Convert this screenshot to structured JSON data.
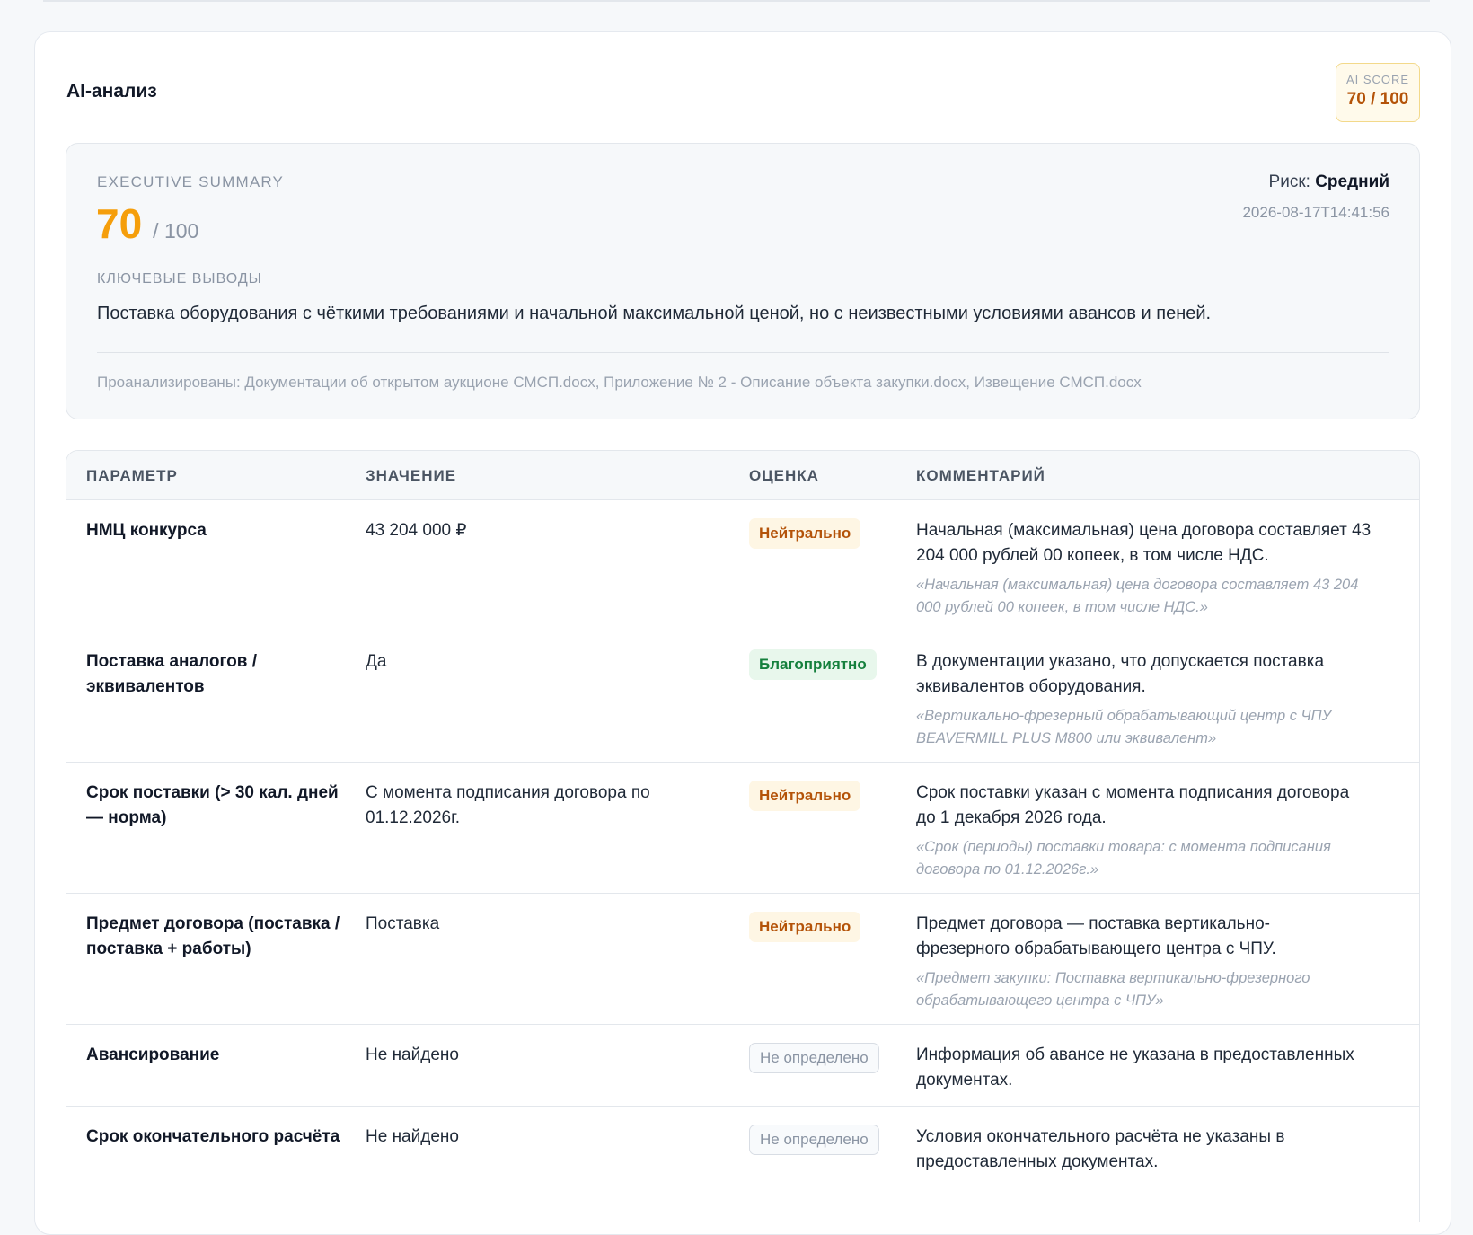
{
  "card": {
    "title": "AI-анализ",
    "ai_score": {
      "label": "AI SCORE",
      "value": "70 / 100"
    }
  },
  "summary": {
    "label": "EXECUTIVE SUMMARY",
    "score": "70",
    "score_denominator": "/ 100",
    "risk_label": "Риск:",
    "risk_value": "Средний",
    "timestamp": "2026-08-17T14:41:56",
    "key_findings_label": "КЛЮЧЕВЫЕ ВЫВОДЫ",
    "key_findings_text": "Поставка оборудования с чёткими требованиями и начальной максимальной ценой, но с неизвестными условиями авансов и пеней.",
    "analyzed": "Проанализированы: Документации об открытом аукционе СМСП.docx, Приложение № 2 - Описание объекта закупки.docx, Извещение СМСП.docx"
  },
  "table": {
    "headers": [
      "ПАРАМЕТР",
      "ЗНАЧЕНИЕ",
      "ОЦЕНКА",
      "КОММЕНТАРИЙ"
    ],
    "rows": [
      {
        "param": "НМЦ конкурса",
        "value": "43 204 000 ₽",
        "eval": "Нейтрально",
        "comment": "Начальная (максимальная) цена договора составляет 43 204 000 рублей 00 копеек, в том числе НДС.",
        "quote": "«Начальная (максимальная) цена договора составляет 43 204 000 рублей 00 копеек, в том числе НДС.»"
      },
      {
        "param": "Поставка аналогов / эквивалентов",
        "value": "Да",
        "eval": "Благоприятно",
        "comment": "В документации указано, что допускается поставка эквивалентов оборудования.",
        "quote": "«Вертикально-фрезерный обрабатывающий центр с ЧПУ BEAVERMILL PLUS M800 или эквивалент»"
      },
      {
        "param": "Срок поставки (> 30 кал. дней — норма)",
        "value": "С момента подписания договора по 01.12.2026г.",
        "eval": "Нейтрально",
        "comment": "Срок поставки указан с момента подписания договора до 1 декабря 2026 года.",
        "quote": "«Срок (периоды) поставки товара: с момента подписания договора по 01.12.2026г.»"
      },
      {
        "param": "Предмет договора (поставка / поставка + работы)",
        "value": "Поставка",
        "eval": "Нейтрально",
        "comment": "Предмет договора — поставка вертикально-фрезерного обрабатывающего центра с ЧПУ.",
        "quote": "«Предмет закупки: Поставка вертикально-фрезерного обрабатывающего центра с ЧПУ»"
      },
      {
        "param": "Авансирование",
        "value": "Не найдено",
        "eval": "Не определено",
        "comment": "Информация об авансе не указана в предоставленных документах.",
        "quote": ""
      },
      {
        "param": "Срок окончательного расчёта",
        "value": "Не найдено",
        "eval": "Не определено",
        "comment": "Условия окончательного расчёта не указаны в предоставленных документах.",
        "quote": ""
      }
    ]
  }
}
